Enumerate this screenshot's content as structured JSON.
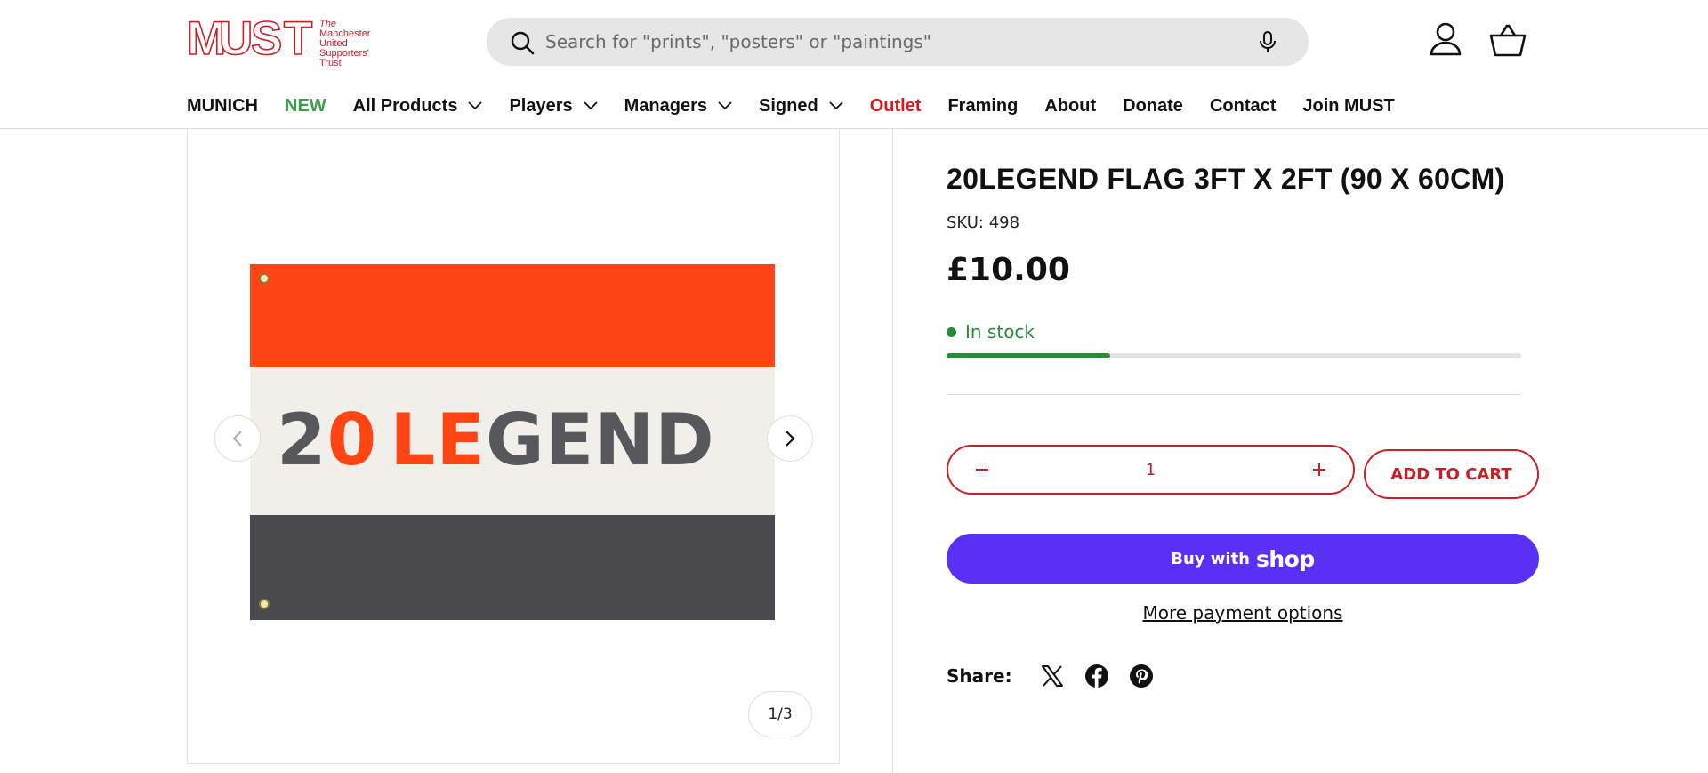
{
  "header": {
    "logo": {
      "letters": [
        "M",
        "U",
        "S",
        "T"
      ],
      "tagline_italic": "The",
      "tagline_lines": [
        "Manchester",
        "United",
        "Supporters'",
        "Trust"
      ]
    },
    "search": {
      "placeholder": "Search for \"prints\", \"posters\" or \"paintings\""
    },
    "icons": {
      "search": "search-icon",
      "mic": "microphone-icon",
      "account": "account-icon",
      "basket": "basket-icon"
    }
  },
  "nav": {
    "items": [
      {
        "label": "MUNICH",
        "dropdown": false,
        "color": "#111111"
      },
      {
        "label": "NEW",
        "dropdown": false,
        "color": "#3aa04a"
      },
      {
        "label": "All Products",
        "dropdown": true,
        "color": "#111111"
      },
      {
        "label": "Players",
        "dropdown": true,
        "color": "#111111"
      },
      {
        "label": "Managers",
        "dropdown": true,
        "color": "#111111"
      },
      {
        "label": "Signed",
        "dropdown": true,
        "color": "#111111"
      },
      {
        "label": "Outlet",
        "dropdown": false,
        "color": "#e0141b"
      },
      {
        "label": "Framing",
        "dropdown": false,
        "color": "#111111"
      },
      {
        "label": "About",
        "dropdown": false,
        "color": "#111111"
      },
      {
        "label": "Donate",
        "dropdown": false,
        "color": "#111111"
      },
      {
        "label": "Contact",
        "dropdown": false,
        "color": "#111111"
      },
      {
        "label": "Join MUST",
        "dropdown": false,
        "color": "#111111"
      }
    ]
  },
  "gallery": {
    "image_text": {
      "part1": "2",
      "part2": "0",
      "part3": "LE",
      "part4": "GEND"
    },
    "colors": {
      "orange": "#ff4513",
      "cream": "#f1efea",
      "charcoal": "#4a4a4e"
    },
    "counter": "1/3"
  },
  "product": {
    "title": "20LEGEND FLAG 3FT X 2FT (90 X 60CM)",
    "sku": "SKU: 498",
    "price": "£10.00",
    "stock_text": "In stock",
    "stock_level": 0.285,
    "quantity": "1",
    "add_to_cart": "ADD TO CART",
    "shop_pay_prefix": "Buy with",
    "shop_pay_brand": "shop",
    "more_payment": "More payment options",
    "share_label": "Share:"
  },
  "colors": {
    "accent": "#c8202a",
    "shop_pay": "#5a31f4",
    "stock": "#2a8a3a"
  }
}
